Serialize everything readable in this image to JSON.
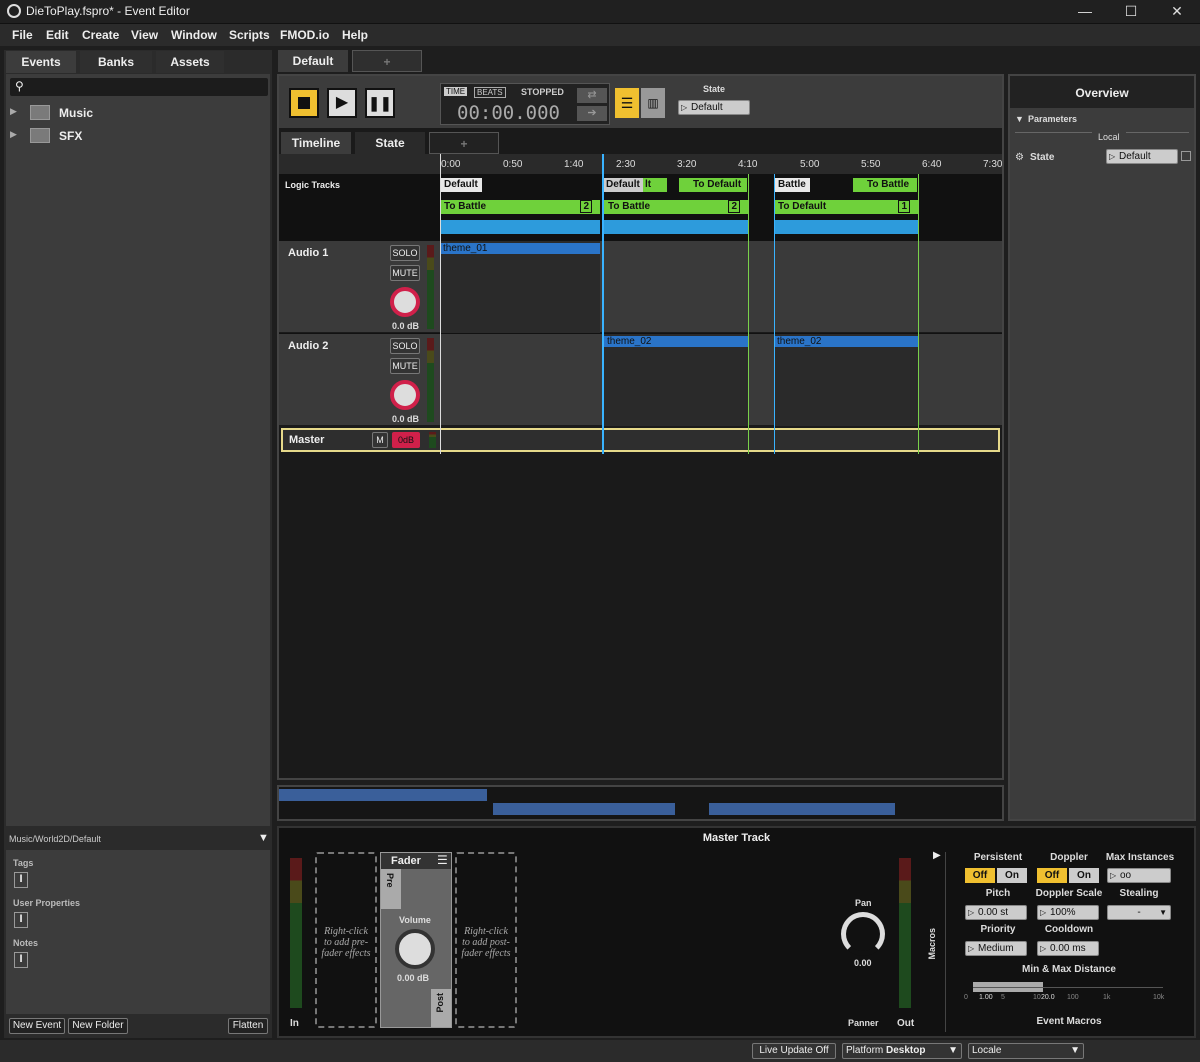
{
  "window": {
    "title": "DieToPlay.fspro* - Event Editor",
    "min": "—",
    "max": "☐",
    "close": "✕"
  },
  "menu": [
    "File",
    "Edit",
    "Create",
    "View",
    "Window",
    "Scripts",
    "FMOD.io",
    "Help"
  ],
  "browser": {
    "tabs": [
      "Events",
      "Banks",
      "Assets"
    ],
    "items": [
      "Music",
      "SFX"
    ],
    "path": "Music/World2D/Default",
    "tags": "Tags",
    "user_props": "User Properties",
    "notes": "Notes",
    "new_event": "New Event",
    "new_folder": "New Folder",
    "flatten": "Flatten"
  },
  "event_tabs": {
    "active": "Default",
    "add": "+"
  },
  "transport": {
    "time": "TIME",
    "beats": "BEATS",
    "status": "STOPPED",
    "timecode": "00:00.000",
    "state_label": "State",
    "state_value": "Default"
  },
  "sub_tabs": {
    "timeline": "Timeline",
    "state": "State",
    "add": "+"
  },
  "ruler": [
    "0:00",
    "0:50",
    "1:40",
    "2:30",
    "3:20",
    "4:10",
    "5:00",
    "5:50",
    "6:40",
    "7:30"
  ],
  "logic": {
    "label": "Logic Tracks",
    "markers": [
      "Default",
      "Default",
      "To Default",
      "Battle",
      "To Battle"
    ],
    "marker_extra": "lt",
    "transitions": [
      {
        "label": "To Battle",
        "count": "2"
      },
      {
        "label": "To Battle",
        "count": "2"
      },
      {
        "label": "To Default",
        "count": "1"
      }
    ]
  },
  "tracks": [
    {
      "name": "Audio 1",
      "solo": "SOLO",
      "mute": "MUTE",
      "vol": "0.0 dB",
      "regions": [
        "theme_01"
      ]
    },
    {
      "name": "Audio 2",
      "solo": "SOLO",
      "mute": "MUTE",
      "vol": "0.0 dB",
      "regions": [
        "theme_02",
        "theme_02"
      ]
    }
  ],
  "master": {
    "name": "Master",
    "m": "M",
    "vol": "0dB"
  },
  "overview": {
    "title": "Overview",
    "params": "Parameters",
    "local": "Local",
    "state": "State",
    "state_value": "Default"
  },
  "deck": {
    "title": "Master Track",
    "in": "In",
    "out": "Out",
    "pre_hint": "Right-click to add pre-fader effects",
    "post_hint": "Right-click to add post-fader effects",
    "fader": "Fader",
    "pre": "Pre",
    "post": "Post",
    "volume": "Volume",
    "vol_value": "0.00 dB",
    "pan": "Pan",
    "pan_value": "0.00",
    "panner": "Panner",
    "macros": "Macros"
  },
  "macros": {
    "persistent": "Persistent",
    "doppler": "Doppler",
    "max_instances": "Max Instances",
    "off": "Off",
    "on": "On",
    "max_inst_value": "oo",
    "pitch": "Pitch",
    "pitch_value": "0.00 st",
    "doppler_scale": "Doppler Scale",
    "doppler_scale_value": "100%",
    "stealing": "Stealing",
    "stealing_value": "-",
    "priority": "Priority",
    "priority_value": "Medium",
    "cooldown": "Cooldown",
    "cooldown_value": "0.00 ms",
    "minmax": "Min & Max Distance",
    "scale": [
      "0",
      "1.00",
      "5",
      "10",
      "20.0",
      "100",
      "1k",
      "10k"
    ],
    "footer": "Event Macros"
  },
  "status": {
    "live": "Live Update Off",
    "platform": "Platform",
    "platform_value": "Desktop",
    "locale": "Locale"
  }
}
